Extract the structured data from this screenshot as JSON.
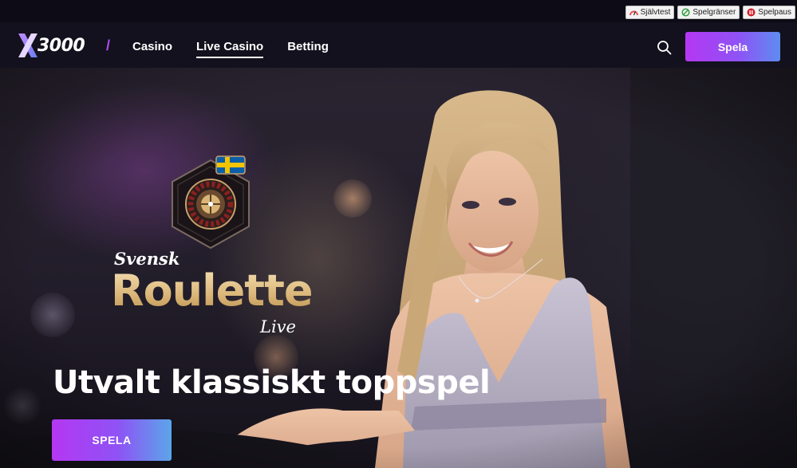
{
  "topbar": {
    "tools": [
      {
        "label": "Självtest",
        "icon": "selftest-icon"
      },
      {
        "label": "Spelgränser",
        "icon": "limits-icon"
      },
      {
        "label": "Spelpaus",
        "icon": "pause-icon"
      }
    ]
  },
  "nav": {
    "logo_text": "3000",
    "links": [
      {
        "label": "Casino",
        "active": false
      },
      {
        "label": "Live Casino",
        "active": true
      },
      {
        "label": "Betting",
        "active": false
      }
    ],
    "cta": "Spela"
  },
  "hero": {
    "game_prefix": "Svensk",
    "game_name": "Roulette",
    "game_suffix": "Live",
    "headline": "Utvalt klassiskt toppspel",
    "cta": "SPELA"
  },
  "colors": {
    "accent": "#b537f2",
    "accent_2": "#5e8cf0",
    "gold": "#d9b577",
    "nav_bg": "#12111d"
  }
}
